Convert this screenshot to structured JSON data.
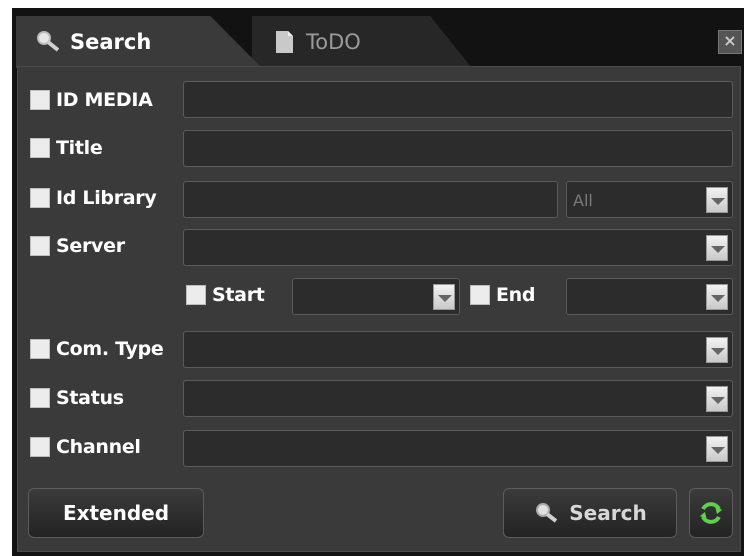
{
  "tabs": [
    {
      "label": "Search",
      "icon": "magnifier-icon"
    },
    {
      "label": "ToDO",
      "icon": "document-icon"
    }
  ],
  "close_label": "×",
  "fields": {
    "id_media": "ID MEDIA",
    "title": "Title",
    "id_library": "Id Library",
    "library_select": "All",
    "server": "Server",
    "start": "Start",
    "end": "End",
    "com_type": "Com. Type",
    "status": "Status",
    "channel": "Channel"
  },
  "buttons": {
    "extended": "Extended",
    "search": "Search"
  },
  "colors": {
    "background": "#3a3a3a",
    "refresh_icon": "#5ed04a"
  }
}
